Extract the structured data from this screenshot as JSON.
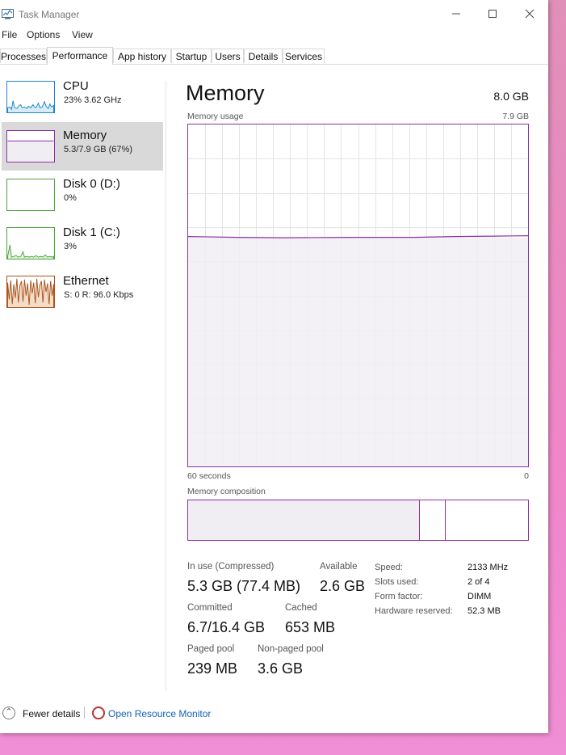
{
  "window": {
    "title": "Task Manager"
  },
  "menu": [
    "File",
    "Options",
    "View"
  ],
  "tabs": [
    "Processes",
    "Performance",
    "App history",
    "Startup",
    "Users",
    "Details",
    "Services"
  ],
  "active_tab": "Performance",
  "sidebar": {
    "items": [
      {
        "name": "CPU",
        "sub": "23%  3.62 GHz",
        "color": "#1d85c6"
      },
      {
        "name": "Memory",
        "sub": "5.3/7.9 GB (67%)",
        "color": "#8b2fa6",
        "selected": true
      },
      {
        "name": "Disk 0 (D:)",
        "sub": "0%",
        "color": "#4da33b"
      },
      {
        "name": "Disk 1 (C:)",
        "sub": "3%",
        "color": "#4da33b"
      },
      {
        "name": "Ethernet",
        "sub": "S: 0  R: 96.0 Kbps",
        "color": "#a7531a"
      }
    ]
  },
  "main": {
    "title": "Memory",
    "total": "8.0 GB",
    "usage_label": "Memory usage",
    "usage_max": "7.9 GB",
    "time_left": "60 seconds",
    "time_right": "0",
    "composition_label": "Memory composition",
    "usage_fraction": 0.67,
    "stats": {
      "in_use_label": "In use (Compressed)",
      "in_use_value": "5.3 GB (77.4 MB)",
      "available_label": "Available",
      "available_value": "2.6 GB",
      "committed_label": "Committed",
      "committed_value": "6.7/16.4 GB",
      "cached_label": "Cached",
      "cached_value": "653 MB",
      "paged_label": "Paged pool",
      "paged_value": "239 MB",
      "nonpaged_label": "Non-paged pool",
      "nonpaged_value": "3.6 GB"
    },
    "details": [
      {
        "label": "Speed:",
        "value": "2133 MHz"
      },
      {
        "label": "Slots used:",
        "value": "2 of 4"
      },
      {
        "label": "Form factor:",
        "value": "DIMM"
      },
      {
        "label": "Hardware reserved:",
        "value": "52.3 MB"
      }
    ]
  },
  "footer": {
    "fewer_details": "Fewer details",
    "open_resource_monitor": "Open Resource Monitor"
  },
  "colors": {
    "memory_accent": "#8b2fa6",
    "memory_fill": "#f1eef3",
    "grid": "#e4e4e4"
  }
}
